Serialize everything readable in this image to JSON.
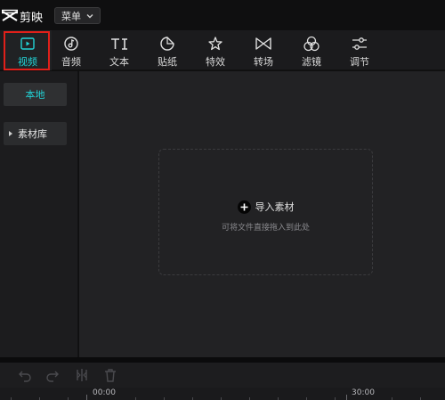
{
  "app": {
    "name": "剪映",
    "menu_label": "菜单"
  },
  "toolbar": {
    "items": [
      {
        "label": "视频",
        "icon": "video-icon",
        "active": true
      },
      {
        "label": "音频",
        "icon": "audio-icon"
      },
      {
        "label": "文本",
        "icon": "text-icon"
      },
      {
        "label": "贴纸",
        "icon": "sticker-icon"
      },
      {
        "label": "特效",
        "icon": "effects-star-icon"
      },
      {
        "label": "转场",
        "icon": "transition-bowtie-icon"
      },
      {
        "label": "滤镜",
        "icon": "filter-circles-icon"
      },
      {
        "label": "调节",
        "icon": "adjust-sliders-icon"
      }
    ]
  },
  "sidebar": {
    "local_label": "本地",
    "library_label": "素材库"
  },
  "import": {
    "label": "导入素材",
    "hint": "可将文件直接拖入到此处"
  },
  "timeline": {
    "start_timecode": "00:00",
    "end_timecode": "30:00"
  },
  "colors": {
    "accent": "#22d3d6",
    "highlight": "#e0201a"
  }
}
